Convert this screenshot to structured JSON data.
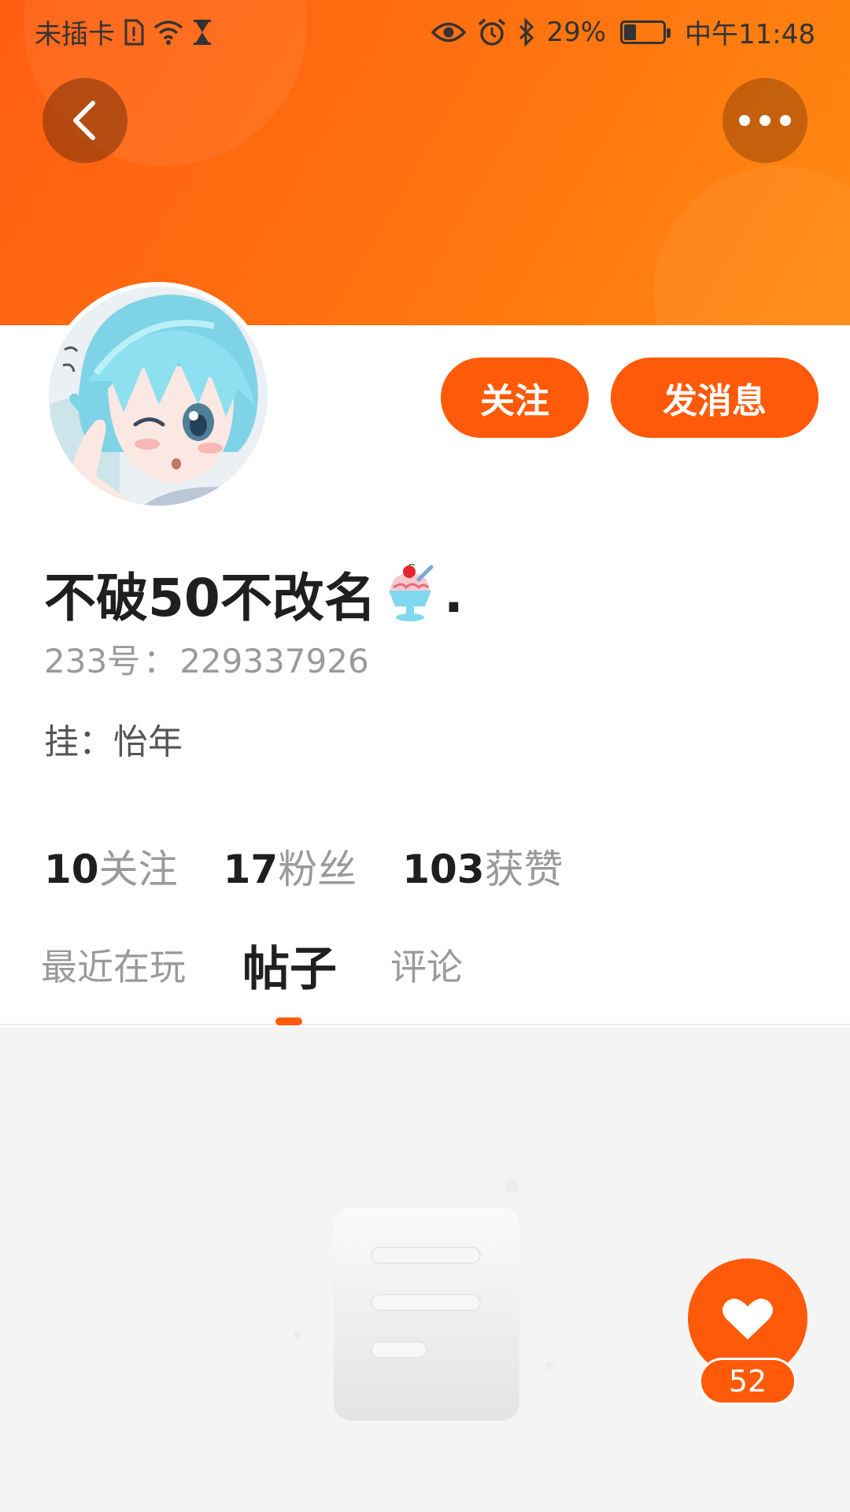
{
  "status_bar": {
    "carrier": "未插卡",
    "battery": "29%",
    "battery_level": 0.29,
    "time": "中午11:48"
  },
  "header": {
    "back_icon": "chevron-left-icon",
    "more_icon": "more-horizontal-icon"
  },
  "profile": {
    "username": "不破50不改名",
    "username_suffix": ".",
    "emoji": "shaved-ice-icon",
    "id_label": "233号",
    "id_sep": "：",
    "id_value": "229337926",
    "bio_label": "挂",
    "bio_sep": "：",
    "bio_value": "怡年"
  },
  "actions": {
    "follow_label": "关注",
    "message_label": "发消息"
  },
  "stats": [
    {
      "value": "10",
      "label": "关注"
    },
    {
      "value": "17",
      "label": "粉丝"
    },
    {
      "value": "103",
      "label": "获赞"
    }
  ],
  "tabs": [
    {
      "label": "最近在玩",
      "active": false
    },
    {
      "label": "帖子",
      "active": true
    },
    {
      "label": "评论",
      "active": false
    }
  ],
  "like": {
    "icon": "heart-icon",
    "count": "52"
  },
  "colors": {
    "accent": "#ff5a0a",
    "banner_start": "#ff5e12",
    "banner_end": "#ff8a10"
  }
}
